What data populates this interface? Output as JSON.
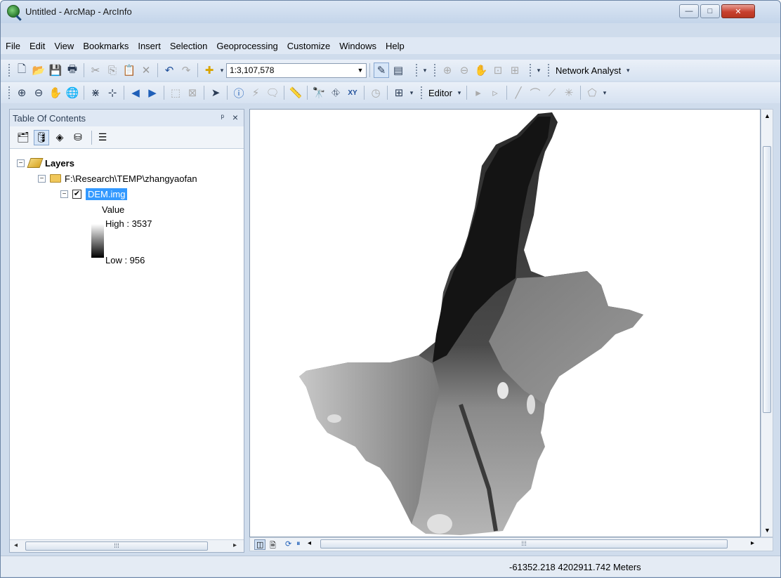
{
  "window": {
    "title": "Untitled - ArcMap - ArcInfo",
    "minimize": "—",
    "maximize": "□",
    "close": "✕"
  },
  "menu": [
    "File",
    "Edit",
    "View",
    "Bookmarks",
    "Insert",
    "Selection",
    "Geoprocessing",
    "Customize",
    "Windows",
    "Help"
  ],
  "toolbar1": {
    "scale": "1:3,107,578",
    "network_analyst": "Network Analyst"
  },
  "toolbar2": {
    "editor": "Editor"
  },
  "toc": {
    "title": "Table Of Contents",
    "pin": "ᵖ",
    "close": "×",
    "layers": "Layers",
    "folder": "F:\\Research\\TEMP\\zhangyaofan",
    "layer_name": "DEM.img",
    "legend_title": "Value",
    "legend_high": "High : 3537",
    "legend_low": "Low : 956"
  },
  "status": {
    "coordinates": "-61352.218  4202911.742 Meters"
  },
  "colors": {
    "selection": "#3399ff",
    "chrome": "#dfe8f4"
  }
}
